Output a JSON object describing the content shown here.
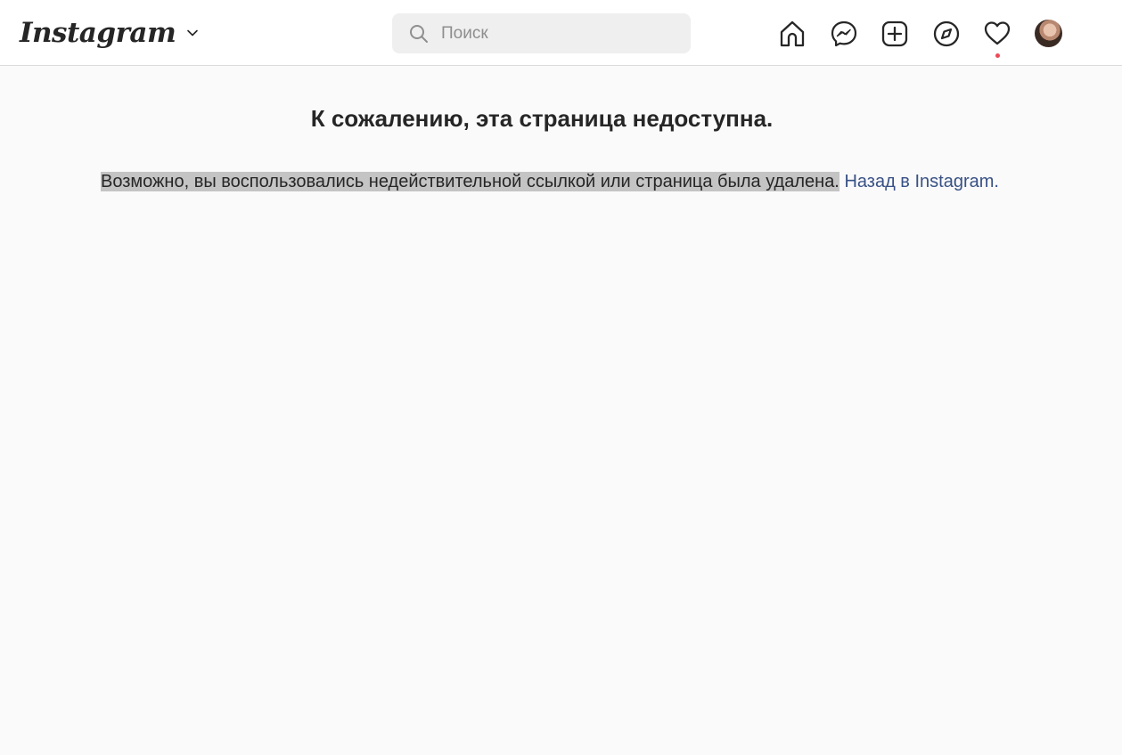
{
  "header": {
    "logo_text": "Instagram",
    "search": {
      "placeholder": "Поиск",
      "value": ""
    },
    "nav_icons": [
      "home-icon",
      "messenger-icon",
      "new-post-icon",
      "explore-icon",
      "activity-heart-icon",
      "profile-avatar"
    ],
    "notification_dot_color": "#ed4956"
  },
  "main": {
    "title": "К сожалению, эта страница недоступна.",
    "message": "Возможно, вы воспользовались недействительной ссылкой или страница была удалена.",
    "back_link": "Назад в Instagram."
  },
  "colors": {
    "background": "#fafafa",
    "link": "#385185",
    "text_highlight": "#c4c4c4"
  }
}
